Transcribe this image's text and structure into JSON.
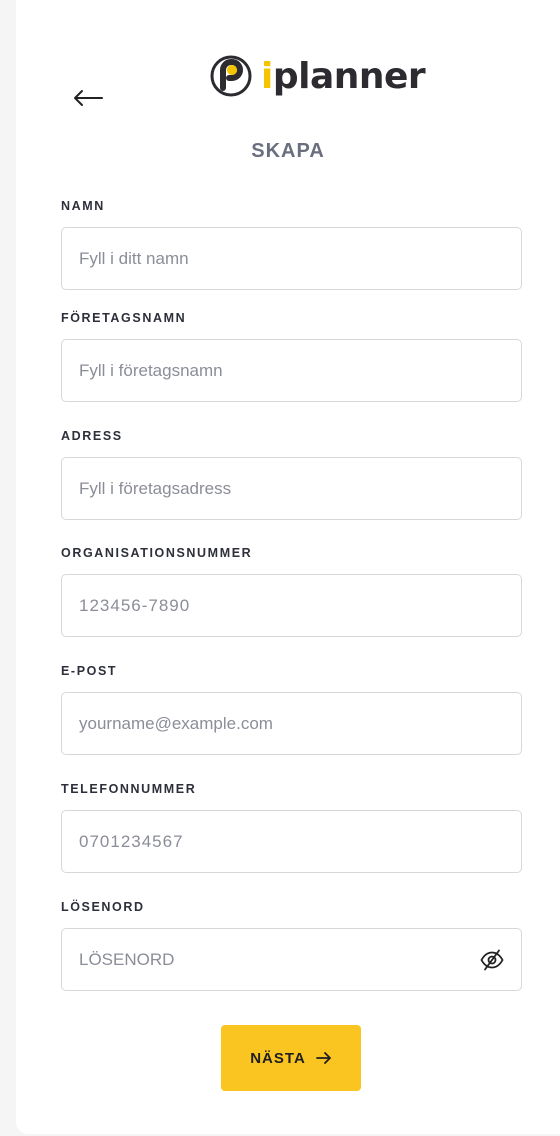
{
  "header": {
    "back_icon": "arrow-left-icon",
    "logo_prefix": "i",
    "logo_rest": "planner",
    "title": "SKAPA"
  },
  "form": {
    "name": {
      "label": "NAMN",
      "placeholder": "Fyll i ditt namn"
    },
    "company": {
      "label": "FÖRETAGSNAMN",
      "placeholder": "Fyll i företagsnamn"
    },
    "address": {
      "label": "ADRESS",
      "placeholder": "Fyll i företagsadress"
    },
    "orgnr": {
      "label": "ORGANISATIONSNUMMER",
      "placeholder": "123456-7890"
    },
    "email": {
      "label": "E-POST",
      "placeholder": "yourname@example.com"
    },
    "phone": {
      "label": "TELEFONNUMMER",
      "placeholder": "0701234567"
    },
    "password": {
      "label": "LÖSENORD",
      "placeholder": "LÖSENORD",
      "toggle_icon": "eye-off-icon"
    }
  },
  "actions": {
    "next_label": "NÄSTA",
    "next_icon": "arrow-right-icon"
  },
  "colors": {
    "accent": "#fac520",
    "logo_accent": "#f5c400",
    "text": "#2d2f3a",
    "title": "#6b6e7e"
  }
}
